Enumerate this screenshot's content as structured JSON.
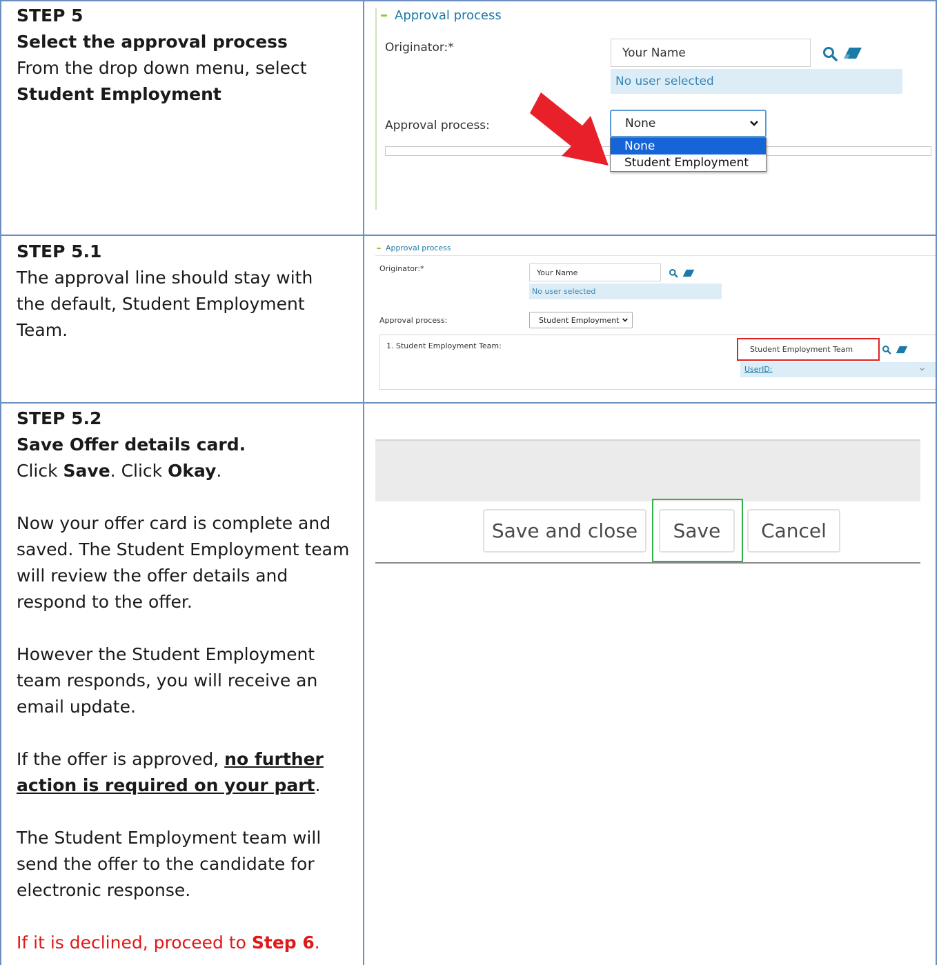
{
  "steps": [
    {
      "title": "STEP 5",
      "subtitle": "Select the approval process",
      "line1": "From the drop down menu, select",
      "line2": "Student Employment"
    },
    {
      "title": "STEP 5.1",
      "body": "The approval line should stay with the default, Student Employment Team."
    },
    {
      "title": "STEP 5.2",
      "subtitle": "Save Offer details card.",
      "click_prefix": "Click ",
      "click_save": "Save",
      "click_mid": ". Click ",
      "click_okay": "Okay",
      "click_end": ".",
      "para1": "Now your offer card is complete and saved. The Student Employment team will review the offer details and respond to the offer.",
      "para2": "However the Student Employment team responds, you will receive an email update.",
      "para3_prefix": "If the offer is approved, ",
      "para3_emph": "no further action is required on your part",
      "para3_end": ".",
      "para4": "The Student Employment team will send the offer to the candidate for electronic response.",
      "para5_prefix": "If it is declined, proceed to ",
      "para5_emph": "Step 6",
      "para5_end": "."
    }
  ],
  "panel1": {
    "section_title": "Approval process",
    "originator_label": "Originator:*",
    "originator_value": "Your Name",
    "no_user": "No user selected",
    "approval_label": "Approval process:",
    "select_value": "None",
    "options": [
      "None",
      "Student Employment"
    ]
  },
  "panel2": {
    "section_title": "Approval process",
    "originator_label": "Originator:*",
    "originator_value": "Your Name",
    "no_user": "No user selected",
    "approval_label": "Approval process:",
    "select_value": "Student Employment",
    "team_row_label": "1. Student Employment Team:",
    "team_value": "Student Employment Team",
    "userid_label": "UserID:"
  },
  "panel3": {
    "save_close": "Save and close",
    "save": "Save",
    "cancel": "Cancel"
  },
  "colors": {
    "accent": "#1a7aa8",
    "arrow": "#e8202a",
    "highlight_red": "#e02020",
    "highlight_green": "#2db34a"
  }
}
